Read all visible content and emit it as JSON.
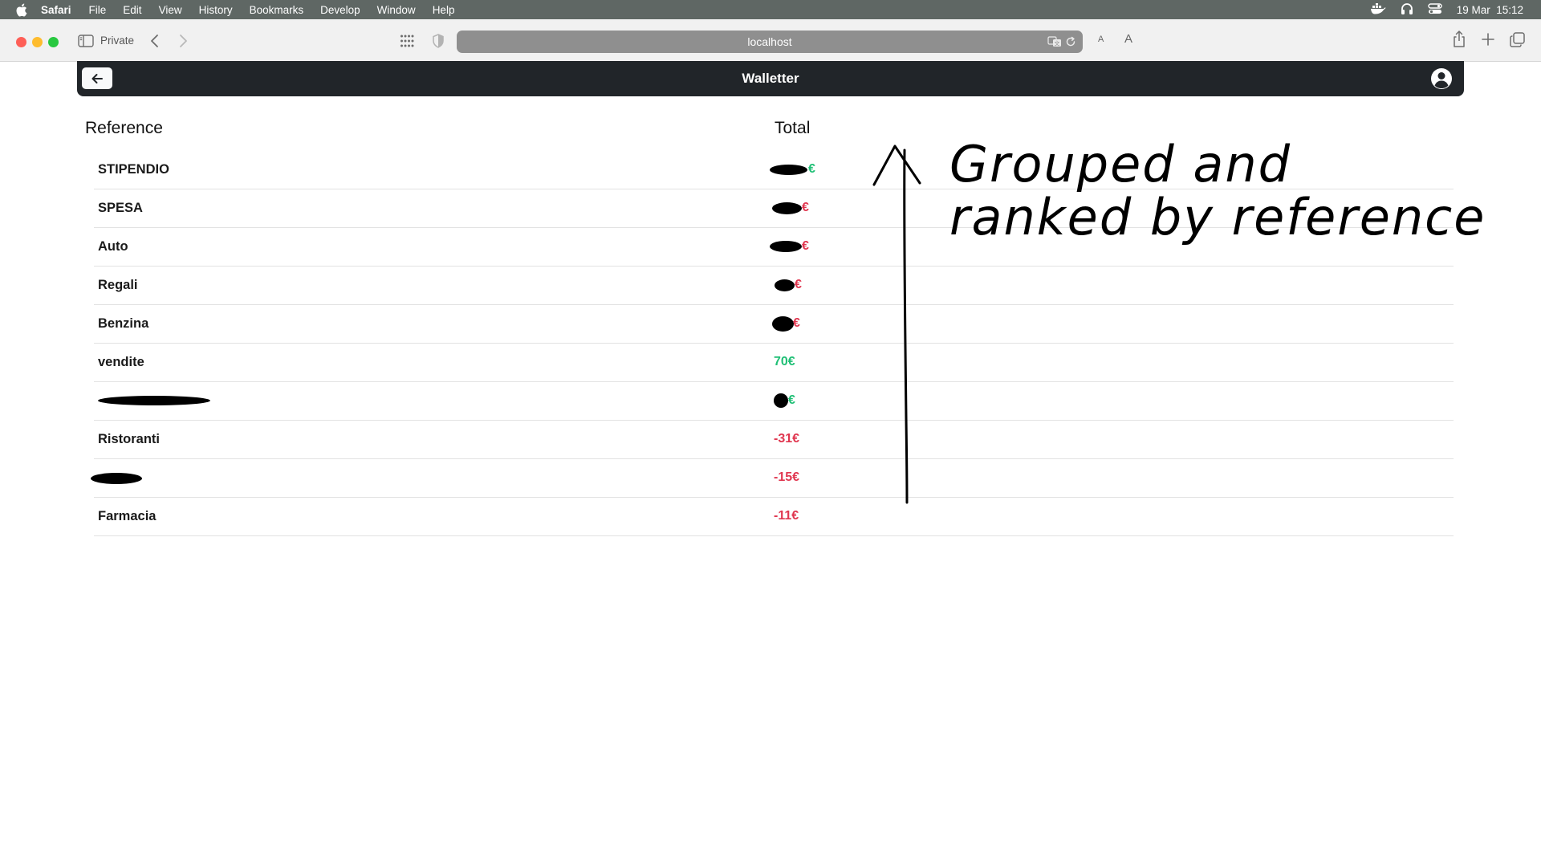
{
  "menubar": {
    "app_name": "Safari",
    "items": [
      "File",
      "Edit",
      "View",
      "History",
      "Bookmarks",
      "Develop",
      "Window",
      "Help"
    ],
    "datetime": "19 Mar  15:12"
  },
  "browser": {
    "private_label": "Private",
    "address": "localhost",
    "text_small": "A",
    "text_large": "A"
  },
  "app": {
    "title": "Walletter",
    "back_icon": "arrow-left-icon",
    "user_icon": "user-circle-icon"
  },
  "table": {
    "headers": {
      "reference": "Reference",
      "total": "Total"
    },
    "rows": [
      {
        "reference": "STIPENDIO",
        "total": "€",
        "sign": "positive",
        "redacted_total": true
      },
      {
        "reference": "SPESA",
        "total": "€",
        "sign": "negative",
        "redacted_total": true
      },
      {
        "reference": "Auto",
        "total": "€",
        "sign": "negative",
        "redacted_total": true
      },
      {
        "reference": "Regali",
        "total": "€",
        "sign": "negative",
        "redacted_total": true
      },
      {
        "reference": "Benzina",
        "total": "€",
        "sign": "negative",
        "redacted_total": true
      },
      {
        "reference": "vendite",
        "total": "70€",
        "sign": "positive",
        "redacted_total": false
      },
      {
        "reference": "",
        "total": "€",
        "sign": "positive",
        "redacted_total": true,
        "redacted_reference": true
      },
      {
        "reference": "Ristoranti",
        "total": "-31€",
        "sign": "negative",
        "redacted_total": false
      },
      {
        "reference": "",
        "total": "-15€",
        "sign": "negative",
        "redacted_total": false,
        "redacted_reference": true
      },
      {
        "reference": "Farmacia",
        "total": "-11€",
        "sign": "negative",
        "redacted_total": false
      }
    ]
  },
  "annotation": {
    "line1": "Grouped and",
    "line2": "ranked by reference"
  },
  "colors": {
    "positive": "#1fbf75",
    "negative": "#e0364f",
    "header_bg": "#212529"
  }
}
